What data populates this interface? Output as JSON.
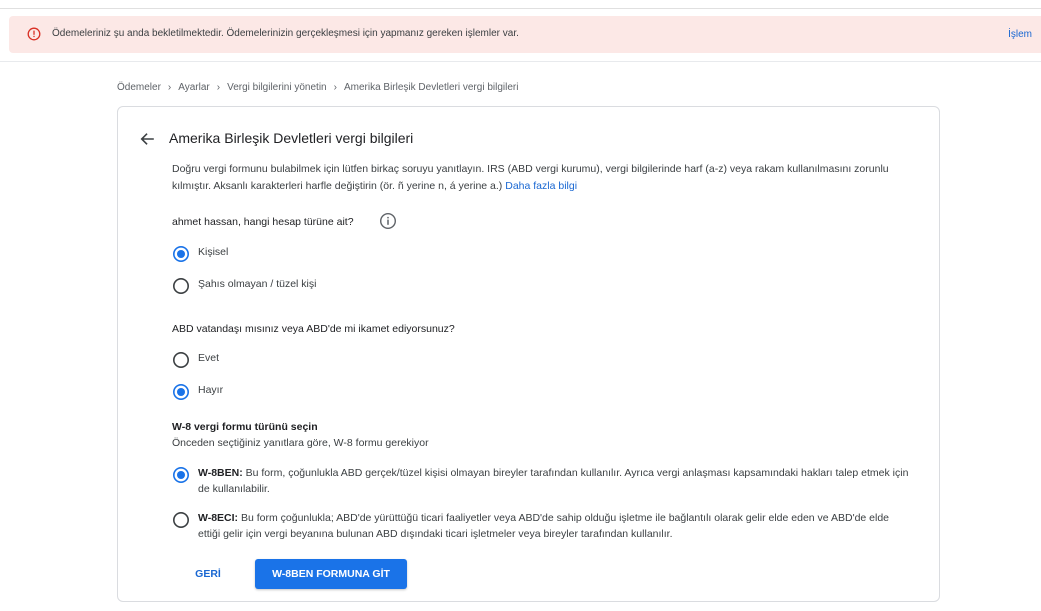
{
  "alert": {
    "message": "Ödemeleriniz şu anda bekletilmektedir. Ödemelerinizin gerçekleşmesi için yapmanız gereken işlemler var.",
    "action_label": "İşlem",
    "icon": "error-circle-icon",
    "color": "#d93025",
    "background": "#fce8e6"
  },
  "breadcrumb": [
    {
      "label": "Ödemeler"
    },
    {
      "label": "Ayarlar"
    },
    {
      "label": "Vergi bilgilerini yönetin"
    },
    {
      "label": "Amerika Birleşik Devletleri vergi bilgileri"
    }
  ],
  "card": {
    "title": "Amerika Birleşik Devletleri vergi bilgileri",
    "description": "Doğru vergi formunu bulabilmek için lütfen birkaç soruyu yanıtlayın. IRS (ABD vergi kurumu), vergi bilgilerinde harf (a-z) veya rakam kullanılmasını zorunlu kılmıştır. Aksanlı karakterleri harfle değiştirin (ör. ñ yerine n, á yerine a.)",
    "learn_more": "Daha fazla bilgi"
  },
  "account_type": {
    "question": "ahmet hassan, hangi hesap türüne ait?",
    "options": [
      {
        "label": "Kişisel",
        "selected": true
      },
      {
        "label": "Şahıs olmayan / tüzel kişi",
        "selected": false
      }
    ]
  },
  "us_person": {
    "question": "ABD vatandaşı mısınız veya ABD'de mi ikamet ediyorsunuz?",
    "options": [
      {
        "label": "Evet",
        "selected": false
      },
      {
        "label": "Hayır",
        "selected": true
      }
    ]
  },
  "w8": {
    "title": "W-8 vergi formu türünü seçin",
    "subtitle": "Önceden seçtiğiniz yanıtlara göre, W-8 formu gerekiyor",
    "options": [
      {
        "code": "W-8BEN:",
        "text": " Bu form, çoğunlukla ABD gerçek/tüzel kişisi olmayan bireyler tarafından kullanılır. Ayrıca vergi anlaşması kapsamındaki hakları talep etmek için de kullanılabilir.",
        "selected": true
      },
      {
        "code": "W-8ECI:",
        "text": " Bu form çoğunlukla; ABD'de yürüttüğü ticari faaliyetler veya ABD'de sahip olduğu işletme ile bağlantılı olarak gelir elde eden ve ABD'de elde ettiği gelir için vergi beyanına bulunan ABD dışındaki ticari işletmeler veya bireyler tarafından kullanılır.",
        "selected": false
      }
    ]
  },
  "actions": {
    "back_label": "GERİ",
    "primary_label": "W-8BEN FORMUNA GİT"
  },
  "colors": {
    "accent": "#1a73e8",
    "link": "#1967d2",
    "radio_inactive": "#5f6368"
  }
}
